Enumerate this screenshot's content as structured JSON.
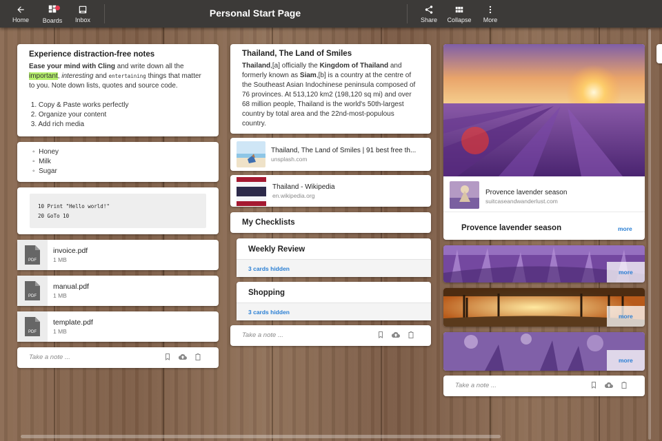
{
  "header": {
    "title": "Personal Start Page",
    "home": "Home",
    "boards": "Boards",
    "inbox": "Inbox",
    "share": "Share",
    "collapse": "Collapse",
    "more": "More"
  },
  "col1": {
    "note": {
      "title": "Experience distraction-free notes",
      "bold1": "Ease your mind with Cling",
      "t1": " and write down all the ",
      "hl": "important",
      "c1": ", ",
      "it": "interesting",
      "c2": " and ",
      "code": "entertaining",
      "t2": " things that matter to you. Note down lists, quotes and source code.",
      "list": [
        "Copy & Paste works perfectly",
        "Organize your content",
        "Add rich media"
      ]
    },
    "grocery": [
      "Honey",
      "Milk",
      "Sugar"
    ],
    "code_lines": [
      "10 Print \"Hello world!\"",
      "20 GoTo 10"
    ],
    "files": [
      {
        "name": "invoice.pdf",
        "size": "1 MB"
      },
      {
        "name": "manual.pdf",
        "size": "1 MB"
      },
      {
        "name": "template.pdf",
        "size": "1 MB"
      }
    ],
    "pdf_label": "PDF",
    "take_note": "Take a note ..."
  },
  "col2": {
    "article": {
      "title": "Thailand, The Land of Smiles",
      "b1": "Thailand",
      "t1": ",[a] officially the ",
      "b2": "Kingdom of Thailand",
      "t2": " and formerly known as ",
      "b3": "Siam",
      "t3": ",[b] is a country at the centre of the Southeast Asian Indochinese peninsula composed of 76 provinces. At 513,120 km2 (198,120 sq mi) and over 68 million people, Thailand is the world's 50th-largest country by total area and the 22nd-most-populous country."
    },
    "links": [
      {
        "title": "Thailand, The Land of Smiles | 91 best free th...",
        "domain": "unsplash.com"
      },
      {
        "title": "Thailand - Wikipedia",
        "domain": "en.wikipedia.org"
      }
    ],
    "checklists_title": "My Checklists",
    "checklists": [
      {
        "title": "Weekly Review",
        "hidden": "3 cards hidden"
      },
      {
        "title": "Shopping",
        "hidden": "3 cards hidden"
      }
    ],
    "take_note": "Take a note ..."
  },
  "col3": {
    "link": {
      "title": "Provence lavender season",
      "domain": "suitcaseandwanderlust.com"
    },
    "caption": "Provence lavender season",
    "more": "more",
    "take_note": "Take a note ..."
  },
  "colors": {
    "accent": "#2a7fd4",
    "highlight": "#b6f06c",
    "topbar": "#3c3a38"
  }
}
